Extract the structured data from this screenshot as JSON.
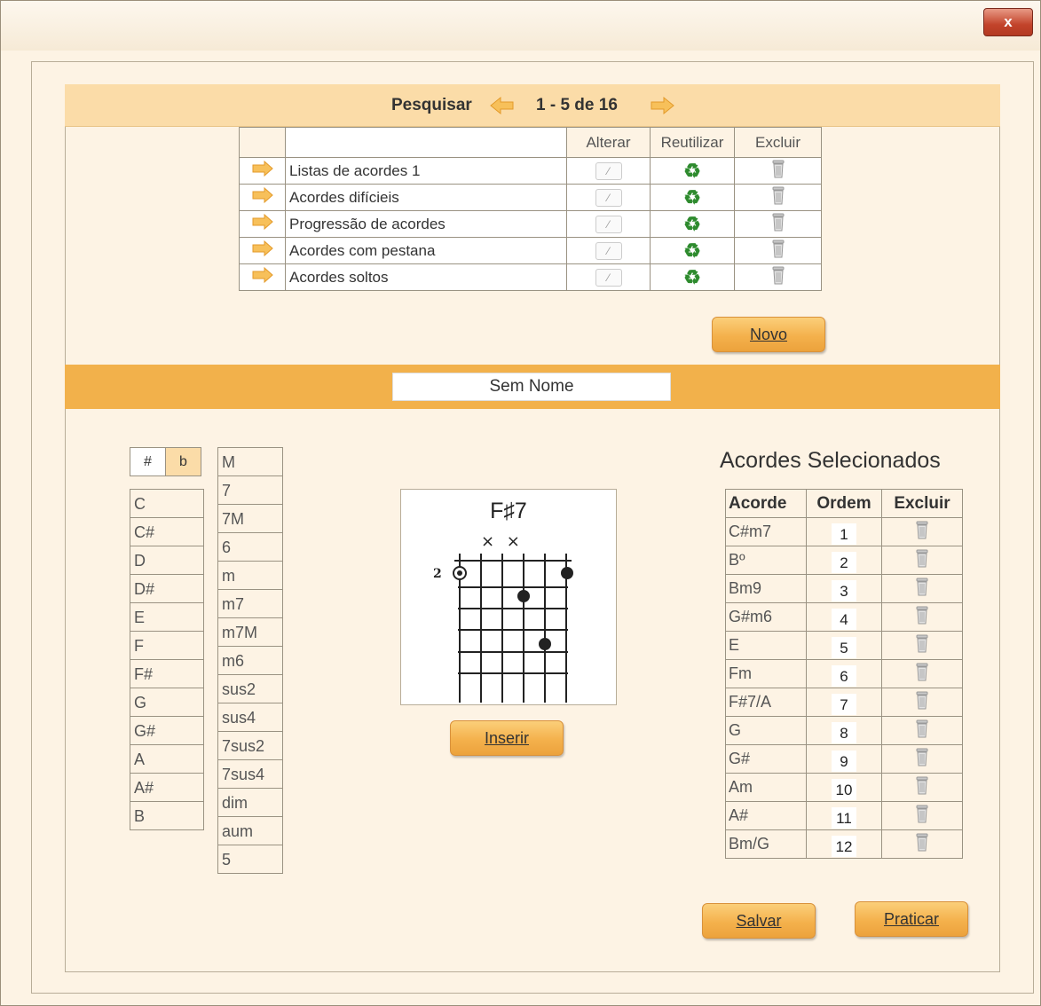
{
  "window": {
    "close_label": "x"
  },
  "search": {
    "label": "Pesquisar",
    "page_label": "1 - 5 de 16"
  },
  "lists_table": {
    "headers": {
      "name": "",
      "edit": "Alterar",
      "reuse": "Reutilizar",
      "delete": "Excluir"
    },
    "rows": [
      "Listas de acordes 1",
      "Acordes difícieis",
      "Progressão de acordes",
      "Acordes com pestana",
      "Acordes soltos"
    ]
  },
  "buttons": {
    "novo": "Novo",
    "inserir": "Inserir",
    "salvar": "Salvar",
    "praticar": "Praticar"
  },
  "list_name": "Sem Nome",
  "accidentals": {
    "sharp": "#",
    "flat": "b"
  },
  "notes": [
    "C",
    "C#",
    "D",
    "D#",
    "E",
    "F",
    "F#",
    "G",
    "G#",
    "A",
    "A#",
    "B"
  ],
  "chord_types": [
    "M",
    "7",
    "7M",
    "6",
    "m",
    "m7",
    "m7M",
    "m6",
    "sus2",
    "sus4",
    "7sus2",
    "7sus4",
    "dim",
    "aum",
    "5"
  ],
  "diagram": {
    "chord_name": "F♯7",
    "fret_label": "2",
    "muted_marks": "× ×"
  },
  "selected": {
    "title": "Acordes Selecionados",
    "headers": {
      "chord": "Acorde",
      "order": "Ordem",
      "delete": "Excluir"
    },
    "rows": [
      {
        "chord": "C#m7",
        "order": "1"
      },
      {
        "chord": "Bº",
        "order": "2"
      },
      {
        "chord": "Bm9",
        "order": "3"
      },
      {
        "chord": "G#m6",
        "order": "4"
      },
      {
        "chord": "E",
        "order": "5"
      },
      {
        "chord": "Fm",
        "order": "6"
      },
      {
        "chord": "F#7/A",
        "order": "7"
      },
      {
        "chord": "G",
        "order": "8"
      },
      {
        "chord": "G#",
        "order": "9"
      },
      {
        "chord": "Am",
        "order": "10"
      },
      {
        "chord": "A#",
        "order": "11"
      },
      {
        "chord": "Bm/G",
        "order": "12"
      }
    ]
  },
  "colors": {
    "accent_orange": "#f2b14b",
    "light_orange": "#fbdca8",
    "panel_bg": "#fdf3e4",
    "close_red": "#c2432a"
  }
}
